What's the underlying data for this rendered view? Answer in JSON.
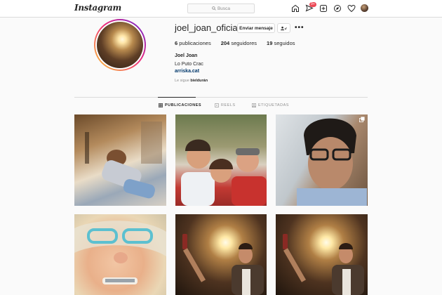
{
  "header": {
    "logo": "Instagram",
    "search_placeholder": "Busca",
    "notification_count": "9+",
    "icons": [
      "home-icon",
      "direct-icon",
      "new-post-icon",
      "explore-icon",
      "activity-icon",
      "profile-avatar"
    ]
  },
  "profile": {
    "username": "joel_joan_oficial",
    "message_button": "Enviar mensaje",
    "posts_count": "6",
    "posts_label": "publicaciones",
    "followers_count": "204",
    "followers_label": "seguidores",
    "following_count": "19",
    "following_label": "seguidos",
    "full_name": "Joel Joan",
    "bio": "Lo Puto Crac",
    "website": "arriska.cat",
    "followed_by_prefix": "Le sigue",
    "followed_by_user": "bieldurán"
  },
  "tabs": [
    {
      "label": "PUBLICACIONES",
      "icon": "grid-icon",
      "active": true
    },
    {
      "label": "REELS",
      "icon": "reels-icon",
      "active": false
    },
    {
      "label": "ETIQUETADAS",
      "icon": "tagged-icon",
      "active": false
    }
  ],
  "colors": {
    "accent_link": "#00376b",
    "notification": "#ed4956",
    "ring_gradient": [
      "#f9ce34",
      "#ee2a7b",
      "#6228d7"
    ]
  }
}
